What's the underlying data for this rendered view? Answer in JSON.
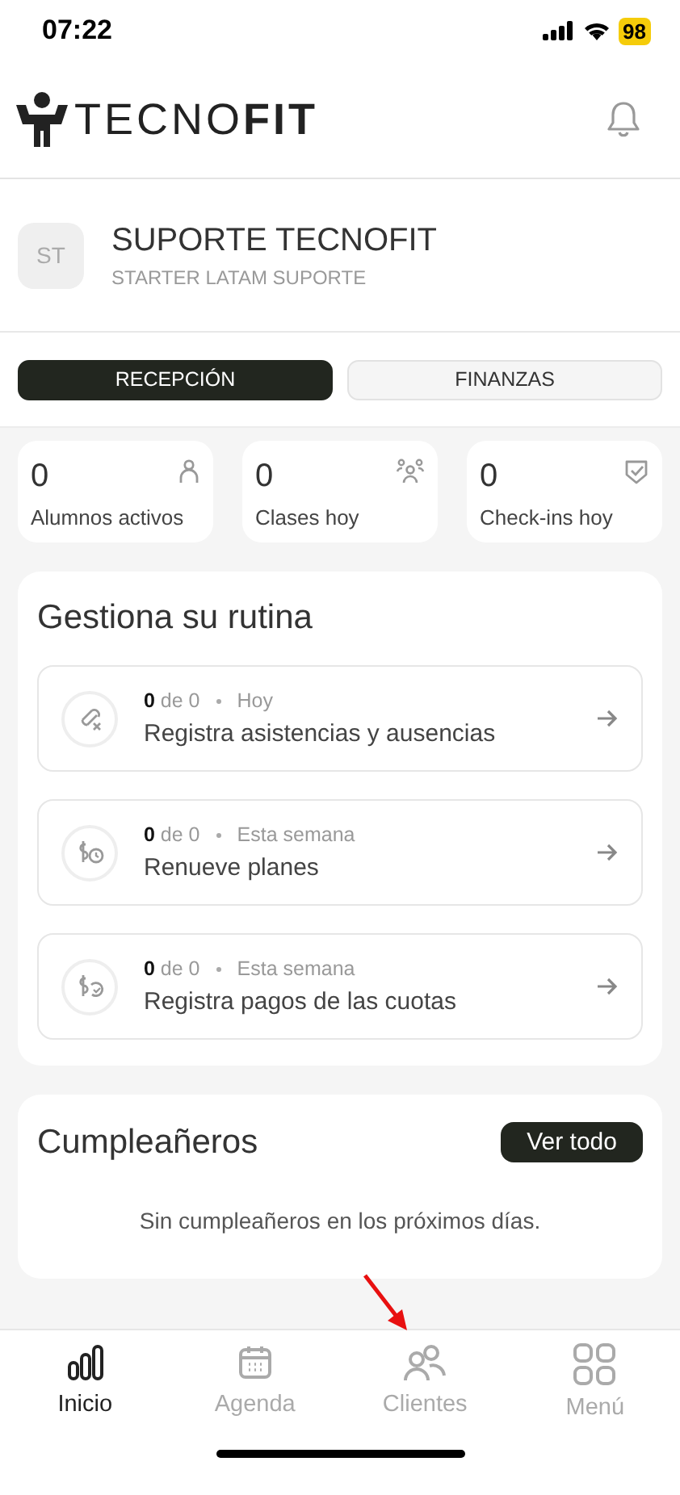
{
  "status_bar": {
    "time": "07:22",
    "battery": "98"
  },
  "header": {
    "logo": "TECNO**FIT**"
  },
  "profile": {
    "initials": "ST",
    "name": "SUPORTE TECNOFIT",
    "plan": "STARTER LATAM SUPORTE"
  },
  "tabs": [
    {
      "label": "RECEPCIÓN",
      "selected": true
    },
    {
      "label": "FINANZAS",
      "selected": false
    }
  ],
  "stats": [
    {
      "value": "0",
      "label": "Alumnos activos",
      "kind": "person"
    },
    {
      "value": "0",
      "label": "Clases hoy",
      "kind": "group"
    },
    {
      "value": "0",
      "label": "Check-ins hoy",
      "kind": "check"
    }
  ],
  "routine": {
    "title": "Gestiona su rutina",
    "tasks": [
      {
        "count": "0",
        "total": "de 0",
        "period": "Hoy",
        "title": "Registra asistencias y ausencias",
        "kind": "attendance"
      },
      {
        "count": "0",
        "total": "de 0",
        "period": "Esta semana",
        "title": "Renueve planes",
        "kind": "renew"
      },
      {
        "count": "0",
        "total": "de 0",
        "period": "Esta semana",
        "title": "Registra pagos de las cuotas",
        "kind": "payment"
      }
    ]
  },
  "birthdays": {
    "title": "Cumpleañeros",
    "button": "Ver todo",
    "empty": "Sin cumpleañeros en los próximos días."
  },
  "nav": [
    {
      "label": "Inicio",
      "kind": "home",
      "selected": true
    },
    {
      "label": "Agenda",
      "kind": "agenda",
      "selected": false
    },
    {
      "label": "Clientes",
      "kind": "clients",
      "selected": false
    },
    {
      "label": "Menú",
      "kind": "menu",
      "selected": false
    }
  ]
}
